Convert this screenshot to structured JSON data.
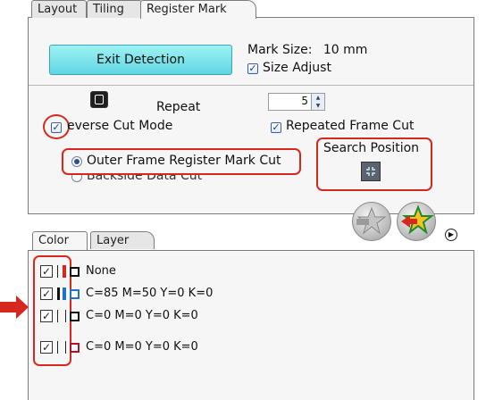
{
  "tabs": [
    {
      "label": "Layout"
    },
    {
      "label": "Tiling"
    },
    {
      "label": "Register Mark"
    }
  ],
  "exit_button": {
    "label": "Exit Detection"
  },
  "mark_size": {
    "label": "Mark Size:",
    "value": "10 mm"
  },
  "size_adjust": {
    "label": "Size Adjust",
    "checked": true
  },
  "repeat": {
    "label": "Repeat",
    "value": "5"
  },
  "reverse_cut": {
    "label": "everse Cut Mode",
    "checked": true
  },
  "repeated_frame_cut": {
    "label": "Repeated Frame Cut",
    "checked": true
  },
  "outer_frame": {
    "label": "Outer Frame Register Mark Cut",
    "selected": true
  },
  "backside": {
    "label": "Backside Data Cut",
    "selected": false
  },
  "search_position": {
    "label": "Search Position",
    "icon": "crosshair-frame-icon"
  },
  "lower_tabs": [
    {
      "label": "Color"
    },
    {
      "label": "Layer"
    }
  ],
  "color_rows": [
    {
      "label": "None",
      "checked": true,
      "swatch": "#111111"
    },
    {
      "label": "C=85 M=50 Y=0 K=0",
      "checked": true,
      "swatch": "#1e73c8"
    },
    {
      "label": "C=0 M=0 Y=0 K=0",
      "checked": true,
      "swatch": "#111111"
    },
    {
      "label": "C=0 M=0 Y=0 K=0",
      "checked": true,
      "swatch": "#b0122a"
    }
  ],
  "colors": {
    "highlight": "#d7281e",
    "button": "#6fe0ea",
    "arrow": "#d7281e"
  }
}
